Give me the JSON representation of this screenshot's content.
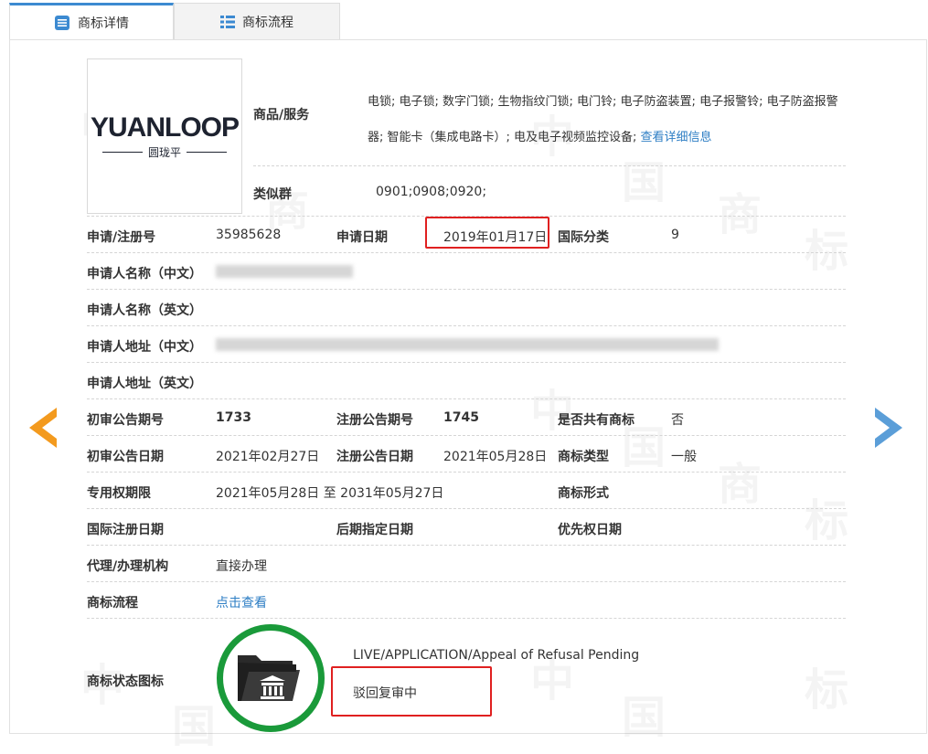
{
  "tabs": [
    {
      "label": "商标详情",
      "active": true
    },
    {
      "label": "商标流程",
      "active": false
    }
  ],
  "watermark": "中国商标",
  "logo": {
    "main": "YUANLOOP",
    "sub": "圆珑平"
  },
  "goods": {
    "label": "商品/服务",
    "value": "电锁; 电子锁; 数字门锁; 生物指纹门锁; 电门铃; 电子防盗装置; 电子报警铃; 电子防盗报警器; 智能卡（集成电路卡）; 电及电子视频监控设备;",
    "link": "查看详细信息"
  },
  "similar_group": {
    "label": "类似群",
    "value": "0901;0908;0920;"
  },
  "reg_no": {
    "label": "申请/注册号",
    "value": "35985628"
  },
  "apply_date": {
    "label": "申请日期",
    "value": "2019年01月17日"
  },
  "intl_class": {
    "label": "国际分类",
    "value": "9"
  },
  "applicant_cn": {
    "label": "申请人名称（中文）"
  },
  "applicant_en": {
    "label": "申请人名称（英文）"
  },
  "address_cn": {
    "label": "申请人地址（中文）"
  },
  "address_en": {
    "label": "申请人地址（英文）"
  },
  "prelim_no": {
    "label": "初审公告期号",
    "value": "1733"
  },
  "reg_pub_no": {
    "label": "注册公告期号",
    "value": "1745"
  },
  "shared": {
    "label": "是否共有商标",
    "value": "否"
  },
  "prelim_date": {
    "label": "初审公告日期",
    "value": "2021年02月27日"
  },
  "reg_pub_date": {
    "label": "注册公告日期",
    "value": "2021年05月28日"
  },
  "mark_type": {
    "label": "商标类型",
    "value": "一般"
  },
  "exclusive": {
    "label": "专用权期限",
    "value": "2021年05月28日 至 2031年05月27日"
  },
  "mark_form": {
    "label": "商标形式"
  },
  "intl_reg_date": {
    "label": "国际注册日期"
  },
  "later_date": {
    "label": "后期指定日期"
  },
  "priority_date": {
    "label": "优先权日期"
  },
  "agent": {
    "label": "代理/办理机构",
    "value": "直接办理"
  },
  "process": {
    "label": "商标流程",
    "link": "点击查看"
  },
  "status": {
    "label": "商标状态图标",
    "en": "LIVE/APPLICATION/Appeal of Refusal Pending",
    "cn": "驳回复审中"
  },
  "colors": {
    "accent": "#3c8ad1",
    "link": "#2d7ec4",
    "highlight": "#e02020",
    "status": "#1a9a3a",
    "prev_arrow": "#f39a1e",
    "next_arrow": "#5b9ed8"
  }
}
